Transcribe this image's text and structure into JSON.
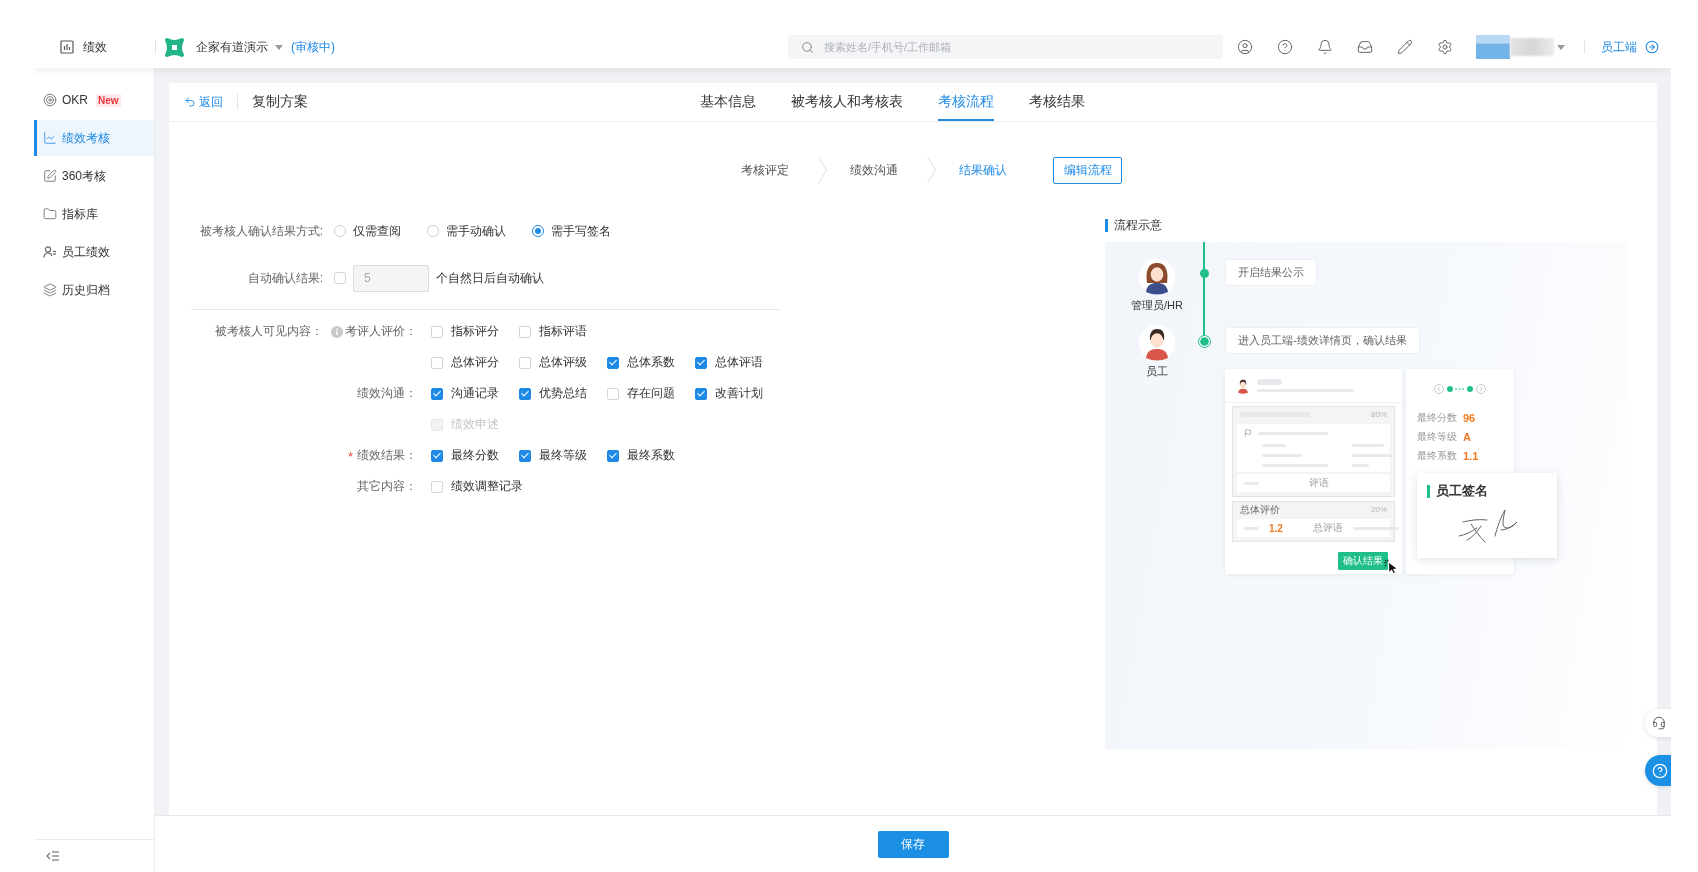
{
  "header": {
    "app_title": "绩效",
    "company": "企家有道演示",
    "company_status": "(审核中)",
    "search": {
      "placeholder": "搜索姓名/手机号/工作邮箱"
    },
    "employee_portal": "员工端"
  },
  "sidebar": {
    "items": [
      {
        "kind": "okr",
        "label": "OKR",
        "badge": "New",
        "selected": false
      },
      {
        "kind": "performance",
        "label": "绩效考核",
        "selected": true
      },
      {
        "kind": "review360",
        "label": "360考核",
        "selected": false
      },
      {
        "kind": "indicators",
        "label": "指标库",
        "selected": false
      },
      {
        "kind": "employees",
        "label": "员工绩效",
        "selected": false
      },
      {
        "kind": "archive",
        "label": "历史归档",
        "selected": false
      }
    ]
  },
  "page": {
    "back": "返回",
    "title": "复制方案",
    "tabs": [
      {
        "label": "基本信息",
        "selected": false
      },
      {
        "label": "被考核人和考核表",
        "selected": false
      },
      {
        "label": "考核流程",
        "selected": true
      },
      {
        "label": "考核结果",
        "selected": false
      }
    ]
  },
  "steps": {
    "items": [
      {
        "label": "考核评定",
        "selected": false
      },
      {
        "label": "绩效沟通",
        "selected": false
      },
      {
        "label": "结果确认",
        "selected": true
      }
    ],
    "edit_button": "编辑流程"
  },
  "form": {
    "confirm_method": {
      "label": "被考核人确认结果方式:",
      "options": [
        {
          "label": "仅需查阅",
          "selected": false
        },
        {
          "label": "需手动确认",
          "selected": false
        },
        {
          "label": "需手写签名",
          "selected": true
        }
      ]
    },
    "auto_confirm": {
      "label": "自动确认结果:",
      "checked": false,
      "days": {
        "value": "5",
        "disabled": true
      },
      "suffix": "个自然日后自动确认"
    },
    "visible_content": {
      "label": "被考核人可见内容：",
      "groups": [
        {
          "label": "考评人评价：",
          "rows": [
            [
              {
                "label": "指标评分",
                "checked": false,
                "disabled": false
              },
              {
                "label": "指标评语",
                "checked": false,
                "disabled": false
              }
            ],
            [
              {
                "label": "总体评分",
                "checked": false,
                "disabled": false
              },
              {
                "label": "总体评级",
                "checked": false,
                "disabled": false
              },
              {
                "label": "总体系数",
                "checked": true,
                "disabled": false
              },
              {
                "label": "总体评语",
                "checked": true,
                "disabled": false
              }
            ]
          ]
        },
        {
          "label": "绩效沟通：",
          "rows": [
            [
              {
                "label": "沟通记录",
                "checked": true,
                "disabled": false
              },
              {
                "label": "优势总结",
                "checked": true,
                "disabled": false
              },
              {
                "label": "存在问题",
                "checked": false,
                "disabled": false
              },
              {
                "label": "改善计划",
                "checked": true,
                "disabled": false
              }
            ],
            [
              {
                "label": "绩效申述",
                "checked": false,
                "disabled": true
              }
            ]
          ]
        },
        {
          "required_mark": "*",
          "label": "绩效结果：",
          "rows": [
            [
              {
                "label": "最终分数",
                "checked": true,
                "disabled": false
              },
              {
                "label": "最终等级",
                "checked": true,
                "disabled": false
              },
              {
                "label": "最终系数",
                "checked": true,
                "disabled": false
              }
            ]
          ]
        },
        {
          "label": "其它内容：",
          "rows": [
            [
              {
                "label": "绩效调整记录",
                "checked": false,
                "disabled": false
              }
            ]
          ]
        }
      ]
    }
  },
  "flow_preview": {
    "title": "流程示意",
    "steps": [
      {
        "kind": "admin",
        "role": "管理员/HR",
        "action": "开启结果公示",
        "current": false
      },
      {
        "kind": "employee",
        "role": "员工",
        "action": "进入员工端-绩效详情页，确认结果",
        "current": true
      }
    ],
    "detail_mock": {
      "section_percent": "80%",
      "comment_label": "评语",
      "overall_label": "总体评价",
      "overall_percent": "20%",
      "overall_score": "1.2",
      "overall_comment_label": "总评语",
      "confirm_button": "确认结果"
    },
    "result_mock": {
      "rows": [
        {
          "label": "最终分数",
          "value": "96"
        },
        {
          "label": "最终等级",
          "value": "A"
        },
        {
          "label": "最终系数",
          "value": "1.1"
        }
      ]
    },
    "signature_mock": {
      "title": "员工签名"
    }
  },
  "footer": {
    "save_button": "保存"
  }
}
